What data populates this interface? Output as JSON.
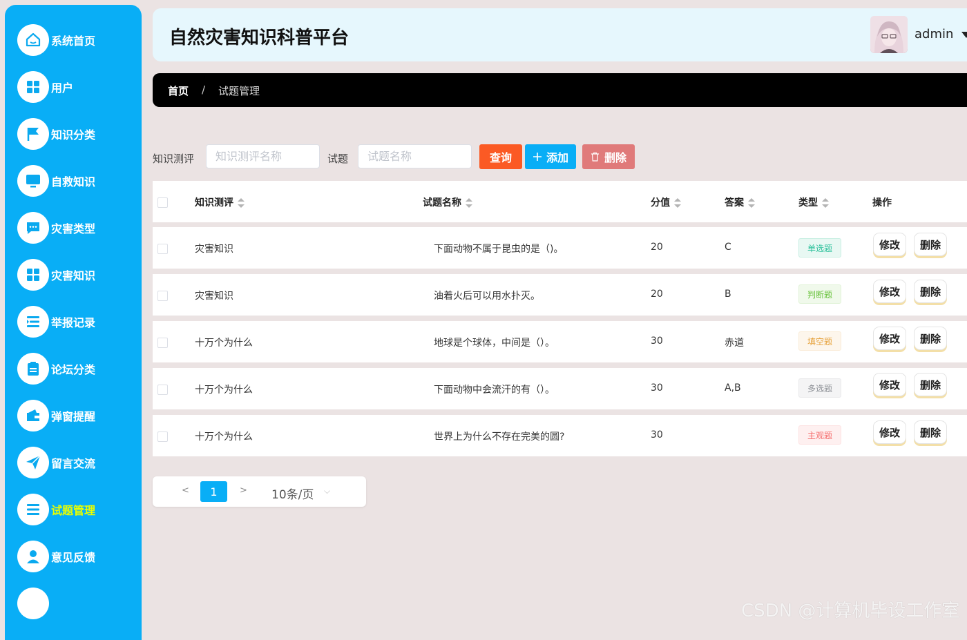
{
  "sidebar": {
    "items": [
      {
        "label": "系统首页",
        "icon": "home-icon"
      },
      {
        "label": "用户",
        "icon": "grid-icon"
      },
      {
        "label": "知识分类",
        "icon": "flag-icon"
      },
      {
        "label": "自救知识",
        "icon": "monitor-icon"
      },
      {
        "label": "灾害类型",
        "icon": "chat-icon"
      },
      {
        "label": "灾害知识",
        "icon": "grid-icon"
      },
      {
        "label": "举报记录",
        "icon": "list-icon"
      },
      {
        "label": "论坛分类",
        "icon": "clipboard-icon"
      },
      {
        "label": "弹窗提醒",
        "icon": "wallet-icon"
      },
      {
        "label": "留言交流",
        "icon": "send-icon"
      },
      {
        "label": "试题管理",
        "icon": "list-icon",
        "active": true
      },
      {
        "label": "意见反馈",
        "icon": "user-icon"
      }
    ],
    "active_color": "#eaff00",
    "bg_color": "#09aef6"
  },
  "header": {
    "title": "自然灾害知识科普平台",
    "username": "admin"
  },
  "breadcrumb": {
    "home": "首页",
    "separator": "/",
    "current": "试题管理"
  },
  "search": {
    "label_exam": "知识测评",
    "placeholder_exam": "知识测评名称",
    "label_question": "试题",
    "placeholder_question": "试题名称",
    "query_label": "查询",
    "add_label": "添加",
    "delete_label": "删除"
  },
  "table": {
    "columns": [
      "知识测评",
      "试题名称",
      "分值",
      "答案",
      "类型",
      "操作"
    ],
    "rows": [
      {
        "exam": "灾害知识",
        "name": "下面动物不属于昆虫的是（)。",
        "score": "20",
        "answer": "C",
        "type": "单选题"
      },
      {
        "exam": "灾害知识",
        "name": "油着火后可以用水扑灭。",
        "score": "20",
        "answer": "B",
        "type": "判断题"
      },
      {
        "exam": "十万个为什么",
        "name": "地球是个球体，中间是（）。",
        "score": "30",
        "answer": "赤道",
        "type": "填空题"
      },
      {
        "exam": "十万个为什么",
        "name": "下面动物中会流汗的有（）。",
        "score": "30",
        "answer": "A,B",
        "type": "多选题"
      },
      {
        "exam": "十万个为什么",
        "name": "世界上为什么不存在完美的圆?",
        "score": "30",
        "answer": "",
        "type": "主观题"
      }
    ],
    "edit_label": "修改",
    "delete_label": "删除"
  },
  "pagination": {
    "prev": "<",
    "page": "1",
    "next": ">",
    "page_size": "10条/页"
  },
  "watermark": "CSDN @计算机毕设工作室",
  "colors": {
    "query": "#fb5a24",
    "add": "#09aef6",
    "delete": "#e07a7a",
    "tag_single_text": "#2dc19c",
    "tag_single_bg": "#e8f8f3",
    "tag_judge_text": "#67c23a",
    "tag_judge_bg": "#f0f9eb",
    "tag_fill_text": "#e6a23c",
    "tag_fill_bg": "#fdf6ec",
    "tag_multi_text": "#909399",
    "tag_multi_bg": "#f4f4f5",
    "tag_subj_text": "#f56c6c",
    "tag_subj_bg": "#fef0f0"
  }
}
